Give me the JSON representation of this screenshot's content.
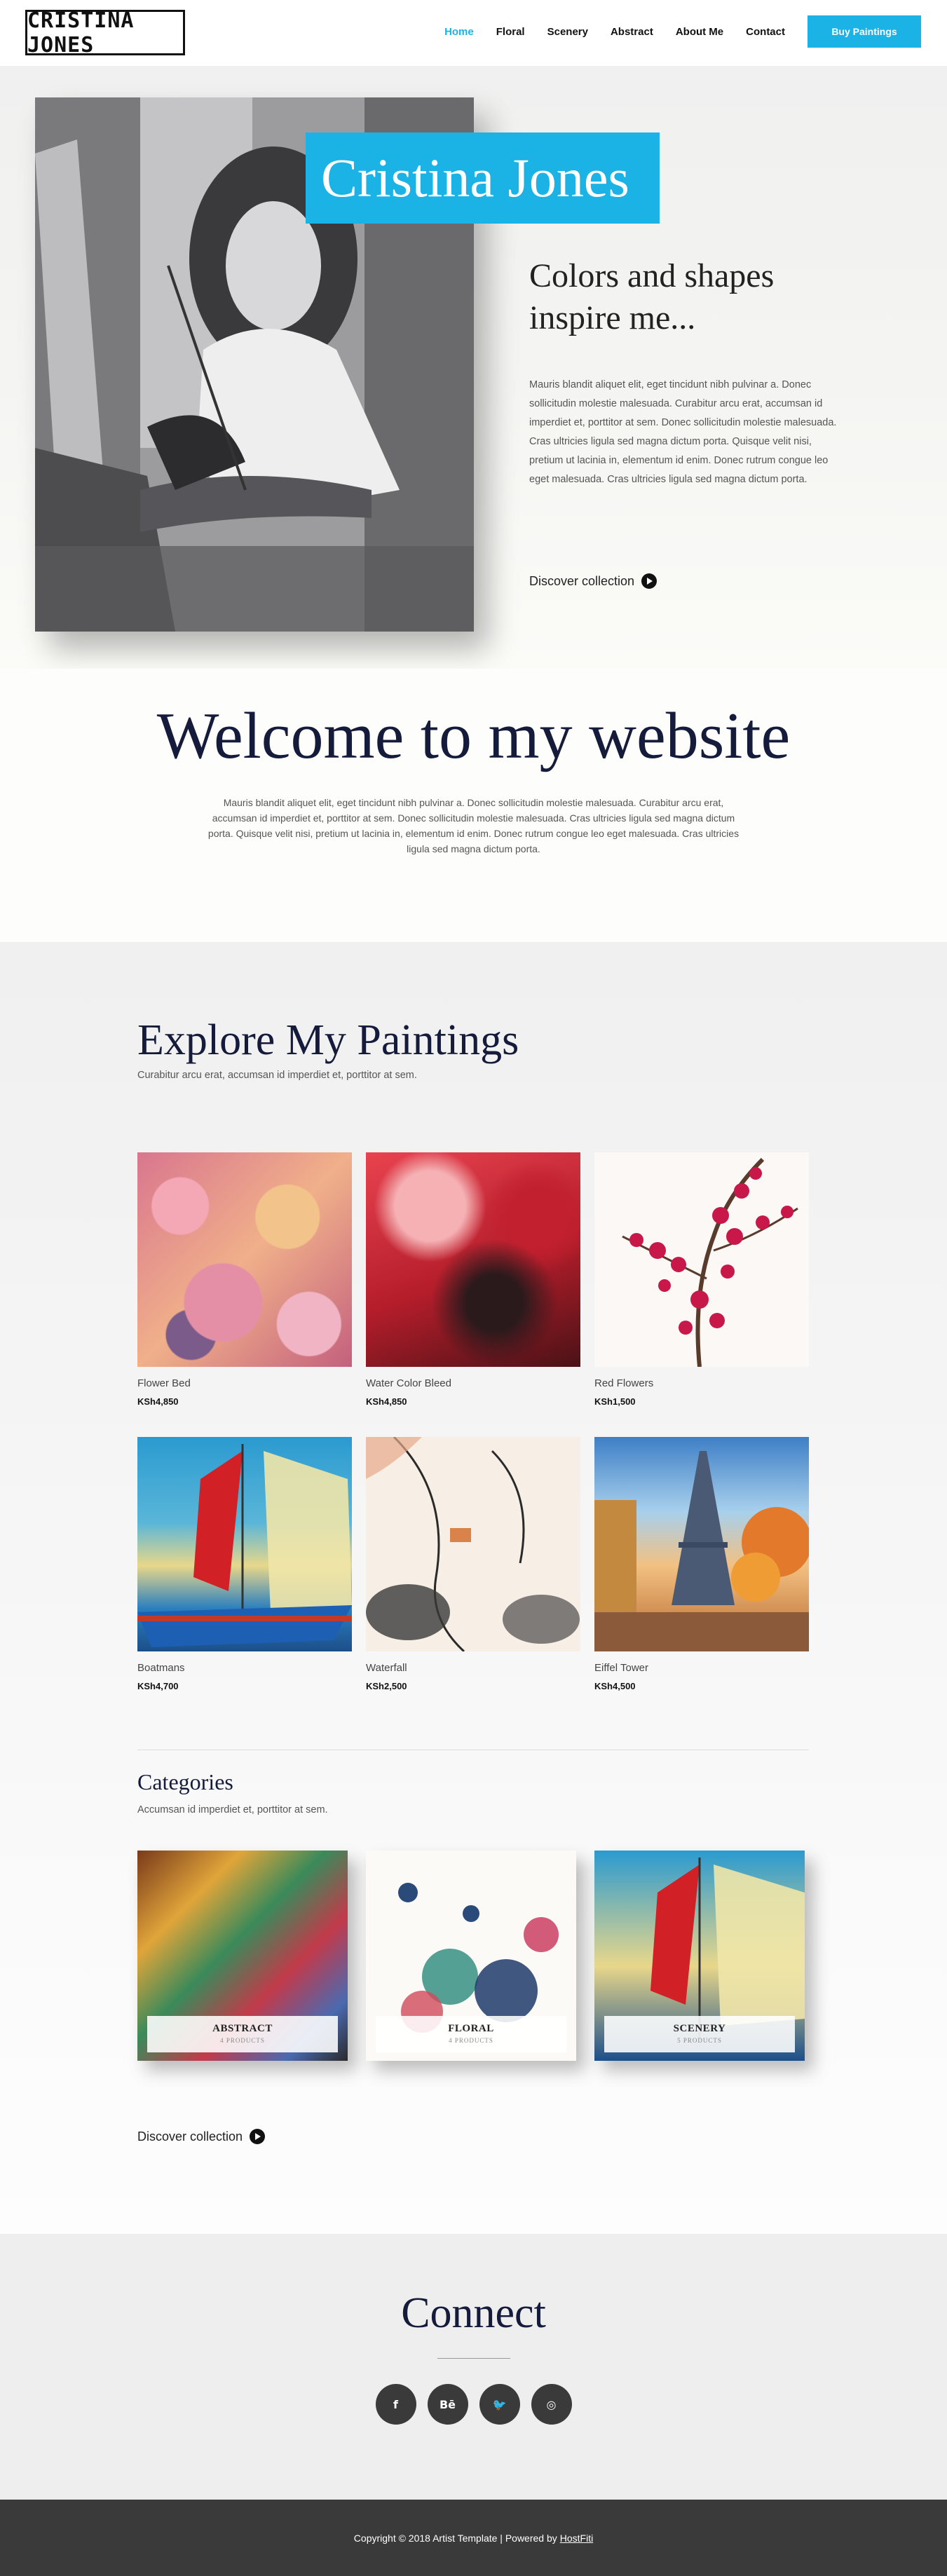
{
  "header": {
    "logo_text": "CRISTINA JONES",
    "nav": [
      {
        "label": "Home",
        "active": true
      },
      {
        "label": "Floral"
      },
      {
        "label": "Scenery"
      },
      {
        "label": "Abstract"
      },
      {
        "label": "About Me"
      },
      {
        "label": "Contact"
      }
    ],
    "buy_button": "Buy Paintings"
  },
  "hero": {
    "name": "Cristina Jones",
    "tagline": "Colors and shapes inspire me...",
    "paragraph": "Mauris blandit aliquet elit, eget tincidunt nibh pulvinar a. Donec sollicitudin molestie malesuada. Curabitur arcu erat, accumsan id imperdiet et, porttitor at sem. Donec sollicitudin molestie malesuada. Cras ultricies ligula sed magna dictum porta. Quisque velit nisi, pretium ut lacinia in, elementum id enim. Donec rutrum congue leo eget malesuada. Cras ultricies ligula sed magna dictum porta.",
    "cta": "Discover collection"
  },
  "welcome": {
    "title": "Welcome to my website",
    "paragraph": "Mauris blandit aliquet elit, eget tincidunt nibh pulvinar a. Donec sollicitudin molestie malesuada. Curabitur arcu erat, accumsan id imperdiet et, porttitor at sem. Donec sollicitudin molestie malesuada. Cras ultricies ligula sed magna dictum porta. Quisque velit nisi, pretium ut lacinia in, elementum id enim. Donec rutrum congue leo eget malesuada. Cras ultricies ligula sed magna dictum porta."
  },
  "paintings": {
    "title": "Explore My Paintings",
    "subtitle": "Curabitur arcu erat, accumsan id imperdiet et, porttitor at sem.",
    "products": [
      {
        "name": "Flower Bed",
        "price": "KSh4,850"
      },
      {
        "name": "Water Color Bleed",
        "price": "KSh4,850"
      },
      {
        "name": "Red Flowers",
        "price": "KSh1,500"
      },
      {
        "name": "Boatmans",
        "price": "KSh4,700"
      },
      {
        "name": "Waterfall",
        "price": "KSh2,500"
      },
      {
        "name": "Eiffel Tower",
        "price": "KSh4,500"
      }
    ]
  },
  "categories": {
    "title": "Categories",
    "subtitle": "Accumsan id imperdiet et, porttitor at sem.",
    "items": [
      {
        "name": "ABSTRACT",
        "count": "4 PRODUCTS"
      },
      {
        "name": "FLORAL",
        "count": "4 PRODUCTS"
      },
      {
        "name": "SCENERY",
        "count": "5 PRODUCTS"
      }
    ],
    "cta": "Discover collection"
  },
  "connect": {
    "title": "Connect",
    "socials": [
      {
        "icon": "facebook-icon",
        "glyph": "f"
      },
      {
        "icon": "behance-icon",
        "glyph": "Bē"
      },
      {
        "icon": "twitter-icon",
        "glyph": "🐦"
      },
      {
        "icon": "instagram-icon",
        "glyph": "◎"
      }
    ]
  },
  "footer": {
    "text": "Copyright © 2018 Artist Template | Powered by",
    "link": "HostFiti"
  },
  "colors": {
    "accent": "#1bb2e6",
    "heading": "#151b3a",
    "footer_bg": "#3a3a3a"
  }
}
